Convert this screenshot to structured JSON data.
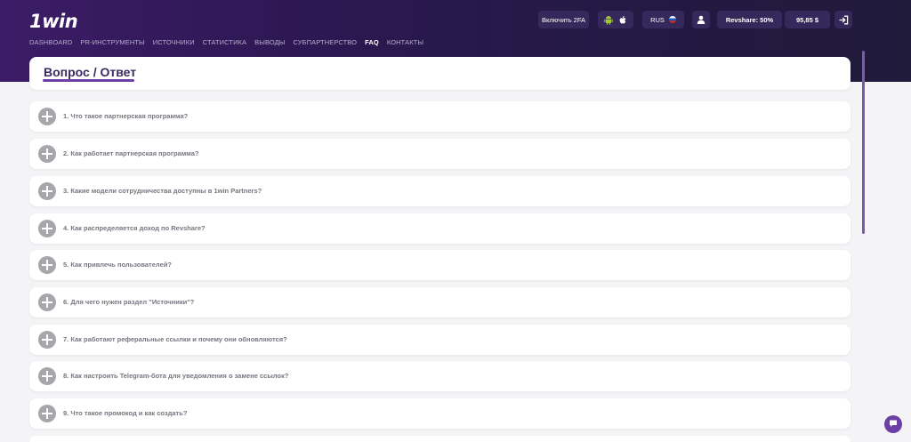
{
  "header": {
    "logo": "1win",
    "nav": [
      {
        "label": "DASHBOARD",
        "active": false
      },
      {
        "label": "PR-ИНСТРУМЕНТЫ",
        "active": false
      },
      {
        "label": "ИСТОЧНИКИ",
        "active": false
      },
      {
        "label": "СТАТИСТИКА",
        "active": false
      },
      {
        "label": "ВЫВОДЫ",
        "active": false
      },
      {
        "label": "СУБПАРТНЕРСТВО",
        "active": false
      },
      {
        "label": "FAQ",
        "active": true
      },
      {
        "label": "КОНТАКТЫ",
        "active": false
      }
    ],
    "enable_2fa": "Включить 2FA",
    "language": "RUS",
    "revshare": "Revshare: 50%",
    "balance": "95,85 $",
    "icons": {
      "android": "android-icon",
      "apple": "apple-icon",
      "flag": "russia-flag-icon",
      "user": "user-icon",
      "logout": "logout-icon",
      "chat": "chat-icon"
    }
  },
  "main": {
    "title": "Вопрос / Ответ",
    "faq": [
      "1. Что такое партнерская программа?",
      "2. Как работает партнерская программа?",
      "3. Какие модели сотрудничества доступны в 1win Partners?",
      "4. Как распределяется доход по Revshare?",
      "5. Как привлечь пользователей?",
      "6. Для чего нужен раздел \"Источники\"?",
      "7. Как работают реферальные ссылки и почему они обновляются?",
      "8. Как настроить Telegram-бота для уведомления о замене ссылок?",
      "9. Что такое промокод и как создать?"
    ]
  },
  "colors": {
    "header_start": "#3c1c66",
    "header_end": "#201a3b",
    "accent": "#6c3ea6",
    "button_bg": "#34295a",
    "page_bg": "#f4f4f6"
  }
}
